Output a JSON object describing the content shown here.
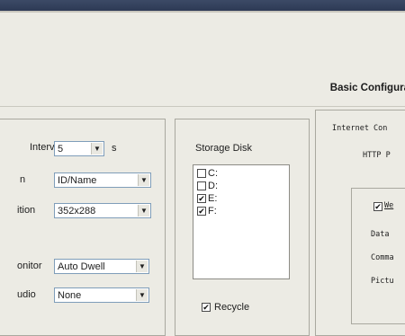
{
  "header": {
    "title": "Basic Configurati"
  },
  "left_panel": {
    "rows": [
      {
        "label": "Interv.",
        "value": "5",
        "suffix": "s"
      },
      {
        "label": "n",
        "value": "ID/Name"
      },
      {
        "label": "ition",
        "value": "352x288"
      },
      {
        "label": "onitor",
        "value": "Auto Dwell"
      },
      {
        "label": "udio",
        "value": "None"
      }
    ]
  },
  "storage": {
    "title": "Storage Disk",
    "disks": [
      {
        "label": "C:",
        "checked": false,
        "mark": ""
      },
      {
        "label": "D:",
        "checked": false,
        "mark": ""
      },
      {
        "label": "E:",
        "checked": true,
        "mark": "✔"
      },
      {
        "label": "F:",
        "checked": true,
        "mark": "✔"
      }
    ],
    "recycle": {
      "label": "Recycle",
      "checked": true,
      "mark": "✔"
    }
  },
  "internet": {
    "title": "Internet Con",
    "http_label": "HTTP P",
    "checkbox_label": "We",
    "checkbox_mark": "✔",
    "data_label": "Data",
    "command_label": "Comma",
    "picture_label": "Pictu"
  },
  "icons": {
    "dropdown": "chevron-down-icon",
    "check": "checkmark-icon"
  }
}
